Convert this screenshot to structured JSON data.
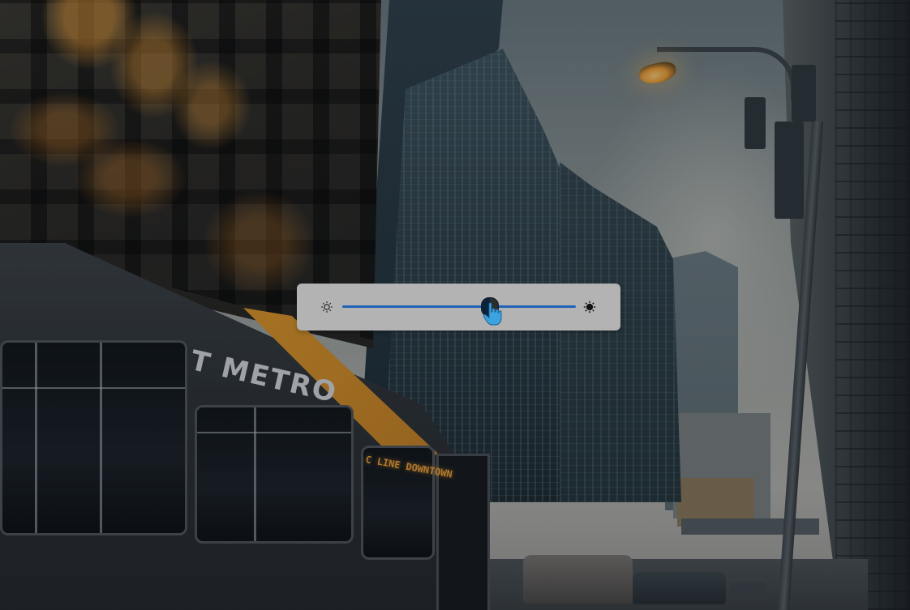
{
  "scene": {
    "description_free": true,
    "bus_logo": "T METRO",
    "bus_destination_sign": "C LINE DOWNTOWN",
    "accent_colors": {
      "lamp": "#f3a233",
      "bus_stripe": "#e29a2a",
      "slider": "#1f63b8"
    }
  },
  "brightness_control": {
    "min_icon": "brightness-low-icon",
    "max_icon": "brightness-high-icon",
    "level": 0.63,
    "cursor_icon": "hand-pointer-icon",
    "colors": {
      "panel": "#b3b3b3",
      "track": "#1f63b8",
      "thumb": "#0d2238",
      "cursor": "#3aa3e0"
    }
  }
}
